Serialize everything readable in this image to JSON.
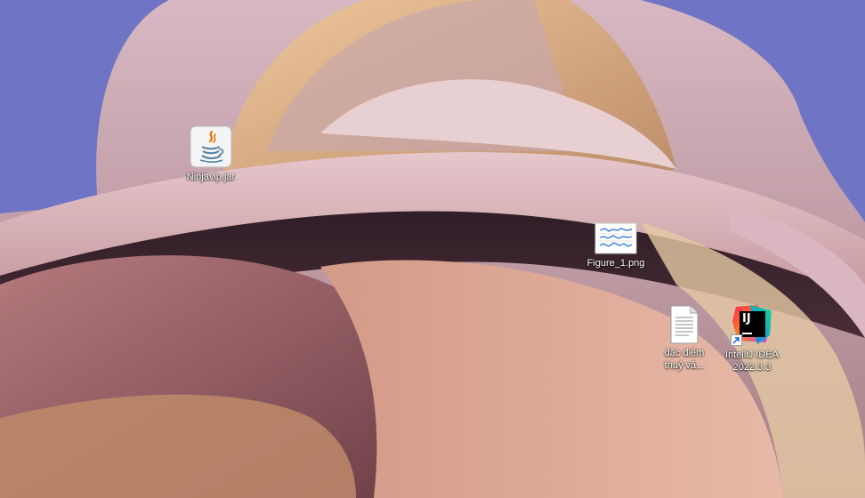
{
  "desktop": {
    "icons": [
      {
        "label": "Ninjavip.jar",
        "icon": "java-icon"
      },
      {
        "label": "Figure_1.png",
        "icon": "image-file-icon"
      },
      {
        "label_lines": [
          "đặc điểm",
          "thuỷ vă..."
        ],
        "icon": "text-document-icon"
      },
      {
        "label_lines": [
          "IntelliJ IDEA",
          "2022.3.3"
        ],
        "icon": "intellij-idea-icon",
        "badge": "IJ"
      }
    ]
  }
}
